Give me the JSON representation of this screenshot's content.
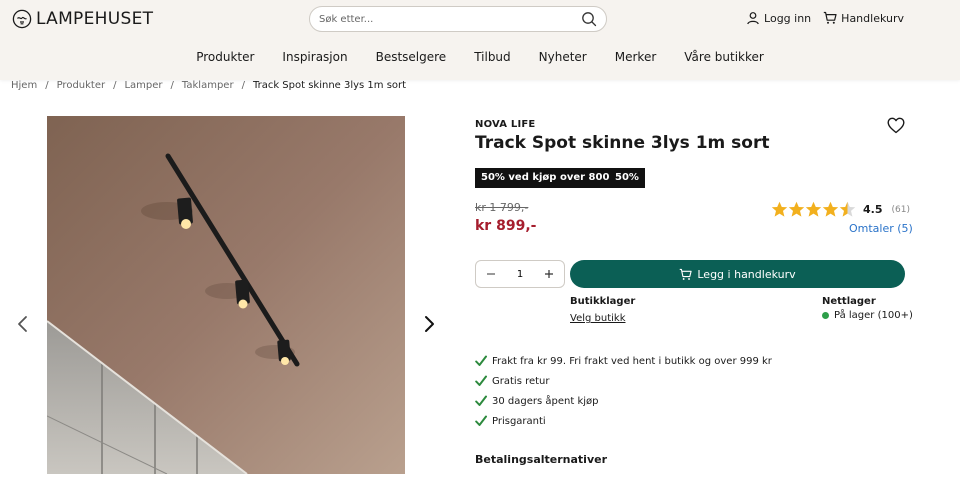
{
  "header": {
    "logo_text": "LAMPEHUSET",
    "search_placeholder": "Søk etter...",
    "login_label": "Logg inn",
    "cart_label": "Handlekurv"
  },
  "nav": {
    "items": [
      "Produkter",
      "Inspirasjon",
      "Bestselgere",
      "Tilbud",
      "Nyheter",
      "Merker",
      "Våre butikker"
    ]
  },
  "breadcrumb": {
    "items": [
      "Hjem",
      "Produkter",
      "Lamper",
      "Taklamper"
    ],
    "current": "Track Spot skinne 3lys 1m sort"
  },
  "product": {
    "brand": "NOVA LIFE",
    "title": "Track Spot skinne 3lys 1m sort",
    "badge_promo": "50% ved kjøp over 800,-",
    "badge_discount": "50%",
    "old_price": "kr 1 799,-",
    "new_price": "kr 899,-",
    "rating_value": "4.5",
    "rating_stars": 4.5,
    "rating_count": "(61)",
    "reviews_link": "Omtaler (5)",
    "quantity": "1",
    "add_to_cart": "Legg i handlekurv",
    "store_stock_label": "Butikklager",
    "choose_store": "Velg butikk",
    "web_stock_label": "Nettlager",
    "web_stock_status": "På lager (100+)",
    "usps": [
      "Frakt fra kr 99. Fri frakt ved hent i butikk og over 999 kr",
      "Gratis retur",
      "30 dagers åpent kjøp",
      "Prisgaranti"
    ],
    "payment_title": "Betalingsalternativer"
  },
  "colors": {
    "header_bg": "#f6f3ef",
    "cta": "#0b5f55",
    "price": "#a51d2d",
    "link": "#2a73c9",
    "star": "#f2b01e",
    "check": "#2d8a3e",
    "in_stock": "#2d9f4a"
  },
  "icons": {
    "logo": "lightbulb-logo-icon",
    "search": "search-icon",
    "user": "user-icon",
    "cart": "cart-icon",
    "favorite": "heart-icon",
    "prev": "chevron-left-icon",
    "next": "chevron-right-icon",
    "check": "check-icon"
  }
}
